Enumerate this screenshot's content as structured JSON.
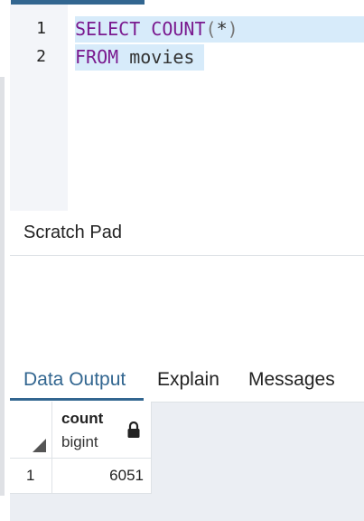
{
  "editor": {
    "line_numbers": [
      "1",
      "2"
    ],
    "lines": [
      {
        "kw1": "SELECT",
        "kw2": "COUNT",
        "open": "(",
        "star": "*",
        "close": ")"
      },
      {
        "kw": "FROM",
        "ident": "movies"
      }
    ]
  },
  "scratch_pad": {
    "title": "Scratch Pad"
  },
  "tabs": [
    {
      "label": "Data Output",
      "active": true
    },
    {
      "label": "Explain",
      "active": false
    },
    {
      "label": "Messages",
      "active": false
    }
  ],
  "results": {
    "columns": [
      {
        "name": "count",
        "type": "bigint"
      }
    ],
    "rows": [
      {
        "row_number": "1",
        "values": [
          "6051"
        ]
      }
    ]
  },
  "colors": {
    "accent": "#326690",
    "keyword": "#7a1a8f",
    "selection": "#d7ebfa"
  }
}
